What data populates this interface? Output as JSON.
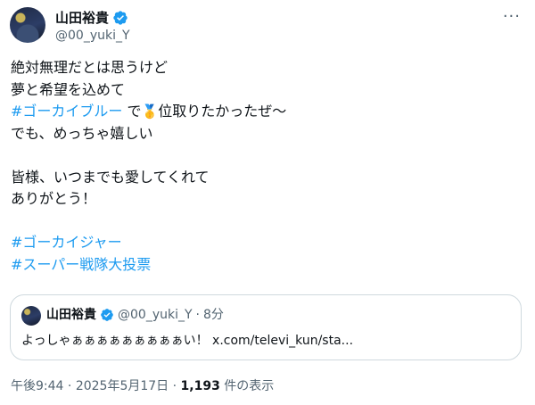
{
  "author": {
    "display_name": "山田裕貴",
    "handle": "@00_yuki_Y",
    "verified_icon": "verified-badge-icon",
    "verified_color": "#1d9bf0"
  },
  "more_icon": "more-options-icon",
  "post": {
    "line1": "絶対無理だとは思うけど",
    "line2": "夢と希望を込めて",
    "line3_hashtag": "#ゴーカイブルー",
    "line3_text": " で",
    "line3_emoji": "🥇",
    "line3_tail": "位取りたかったぜ〜",
    "line4": "でも、めっちゃ嬉しい",
    "line5": "皆様、いつまでも愛してくれて",
    "line6": "ありがとう！",
    "hashtag1": "#ゴーカイジャー",
    "hashtag2": "#スーパー戦隊大投票"
  },
  "quote": {
    "display_name": "山田裕貴",
    "handle": "@00_yuki_Y",
    "separator": "·",
    "time": "8分",
    "text": "よっしゃぁぁぁぁぁぁぁぁぁい！ x.com/televi_kun/sta..."
  },
  "meta": {
    "time": "午後9:44",
    "separator": " · ",
    "date": "2025年5月17日",
    "views_count": "1,193",
    "views_label": " 件の表示"
  },
  "colors": {
    "link": "#1d9bf0",
    "secondary_text": "#536471",
    "border": "#cfd9de"
  }
}
